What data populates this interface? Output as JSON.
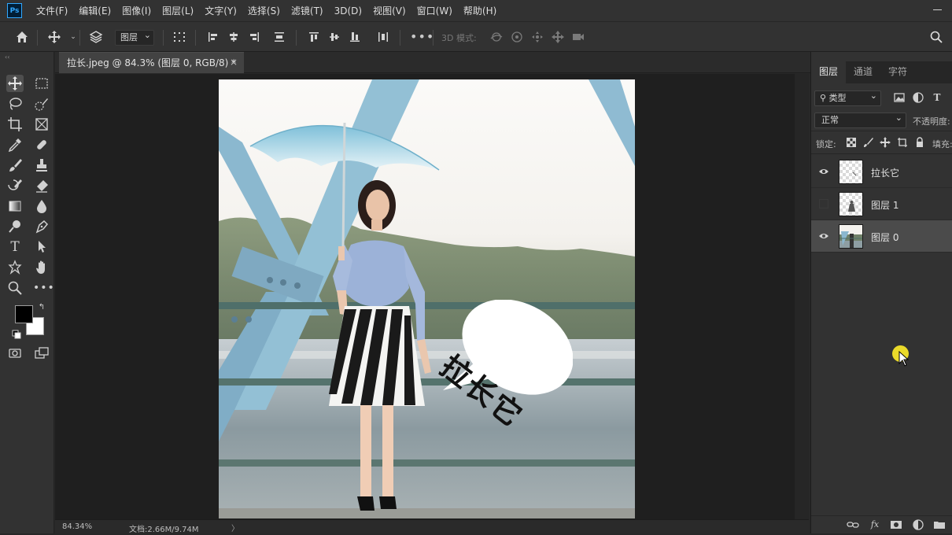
{
  "app": {
    "logo": "Ps"
  },
  "menu": [
    "文件(F)",
    "编辑(E)",
    "图像(I)",
    "图层(L)",
    "文字(Y)",
    "选择(S)",
    "滤镜(T)",
    "3D(D)",
    "视图(V)",
    "窗口(W)",
    "帮助(H)"
  ],
  "options": {
    "auto_select_target": "图层",
    "mode3d_label": "3D 模式:"
  },
  "document": {
    "tab_title": "拉长.jpeg @ 84.3% (图层 0, RGB/8) *",
    "close_glyph": "×",
    "speech_bubble_text": "拉长它"
  },
  "status": {
    "zoom": "84.34%",
    "doc_info": "文档:2.66M/9.74M",
    "arrow": "〉"
  },
  "layers_panel": {
    "tabs": [
      "图层",
      "通道",
      "字符"
    ],
    "active_tab": 0,
    "filter_label": "类型",
    "blend_mode": "正常",
    "opacity_label": "不透明度:",
    "lock_label": "锁定:",
    "fill_label": "填充:",
    "layers": [
      {
        "name": "拉长它",
        "visible": true,
        "selected": false
      },
      {
        "name": "图层 1",
        "visible": false,
        "selected": false
      },
      {
        "name": "图层 0",
        "visible": true,
        "selected": true
      }
    ]
  },
  "colors": {
    "accent": "#31a8ff",
    "foreground": "#000000",
    "background": "#ffffff",
    "cursor_highlight": "#f4e42a"
  }
}
